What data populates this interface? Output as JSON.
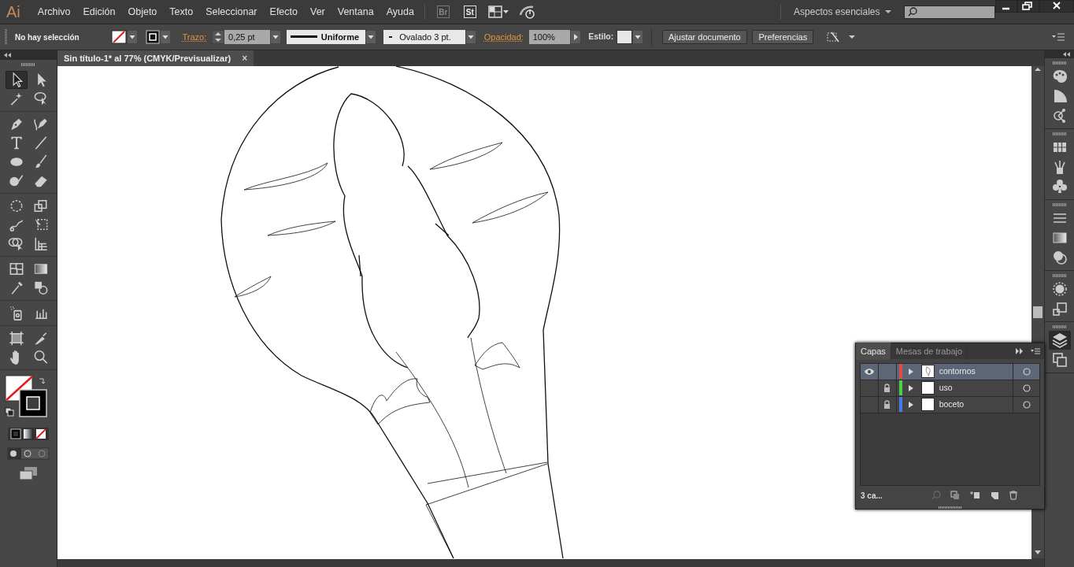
{
  "app": {
    "logo": "Ai",
    "menus": [
      "Archivo",
      "Edición",
      "Objeto",
      "Texto",
      "Seleccionar",
      "Efecto",
      "Ver",
      "Ventana",
      "Ayuda"
    ],
    "bridge": "Br",
    "stock": "St",
    "workspace": "Aspectos esenciales"
  },
  "control_bar": {
    "selection_status": "No hay selección",
    "stroke_label": "Trazo:",
    "stroke_weight": "0,25 pt",
    "stroke_profile": "Uniforme",
    "brush": "Ovalado 3 pt.",
    "opacity_label": "Opacidad:",
    "opacity": "100%",
    "style_label": "Estilo:",
    "buttons": [
      "Ajustar documento",
      "Preferencias"
    ]
  },
  "document_tab": {
    "title": "Sin título-1* al 77% (CMYK/Previsualizar)",
    "close": "×"
  },
  "tool_groups": [
    {
      "tools": [
        {
          "kind": "selection",
          "selected": true
        },
        {
          "kind": "direct",
          "selected": false
        },
        {
          "kind": "wand",
          "selected": false
        },
        {
          "kind": "lasso",
          "selected": false
        }
      ]
    },
    {
      "tools": [
        {
          "kind": "pen",
          "selected": false
        },
        {
          "kind": "curvature",
          "selected": false
        },
        {
          "kind": "type",
          "selected": false
        },
        {
          "kind": "line",
          "selected": false
        },
        {
          "kind": "ellipse",
          "selected": false
        },
        {
          "kind": "brush",
          "selected": false
        },
        {
          "kind": "blob",
          "selected": false
        },
        {
          "kind": "eraser",
          "selected": false
        }
      ]
    },
    {
      "tools": [
        {
          "kind": "rotate",
          "selected": false
        },
        {
          "kind": "scale",
          "selected": false
        },
        {
          "kind": "warp",
          "selected": false
        },
        {
          "kind": "freetransform",
          "selected": false
        },
        {
          "kind": "shapebuilder",
          "selected": false
        },
        {
          "kind": "perspective",
          "selected": false
        }
      ]
    },
    {
      "tools": [
        {
          "kind": "mesh",
          "selected": false
        },
        {
          "kind": "gradient",
          "selected": false
        },
        {
          "kind": "eyedropper",
          "selected": false
        },
        {
          "kind": "blend",
          "selected": false
        }
      ]
    },
    {
      "tools": [
        {
          "kind": "spray",
          "selected": false
        },
        {
          "kind": "graph",
          "selected": false
        }
      ]
    },
    {
      "tools": [
        {
          "kind": "artboard",
          "selected": false
        },
        {
          "kind": "slice",
          "selected": false
        },
        {
          "kind": "hand",
          "selected": false
        },
        {
          "kind": "zoom",
          "selected": false
        }
      ]
    }
  ],
  "dock": [
    {
      "items": [
        {
          "kind": "palette",
          "selected": false
        },
        {
          "kind": "guide",
          "selected": false
        },
        {
          "kind": "link",
          "selected": false
        }
      ]
    },
    {
      "items": [
        {
          "kind": "swatches",
          "selected": false
        },
        {
          "kind": "brushes",
          "selected": false
        },
        {
          "kind": "club",
          "selected": false
        }
      ]
    },
    {
      "items": [
        {
          "kind": "stroke",
          "selected": false
        },
        {
          "kind": "gradient",
          "selected": false
        },
        {
          "kind": "transparency",
          "selected": false
        }
      ]
    },
    {
      "items": [
        {
          "kind": "appearance",
          "selected": false
        },
        {
          "kind": "transform",
          "selected": false
        }
      ]
    },
    {
      "items": [
        {
          "kind": "layers",
          "selected": true
        },
        {
          "kind": "artboards",
          "selected": false
        }
      ]
    }
  ],
  "layers_panel": {
    "tabs": [
      {
        "label": "Capas",
        "selected": true
      },
      {
        "label": "Mesas de trabajo",
        "selected": false
      }
    ],
    "layers": [
      {
        "name": "contornos",
        "visible": true,
        "locked": false,
        "color": "#e24a4a",
        "selected": true
      },
      {
        "name": "uso",
        "visible": false,
        "locked": true,
        "color": "#44d444",
        "selected": false
      },
      {
        "name": "boceto",
        "visible": false,
        "locked": true,
        "color": "#4a7ae6",
        "selected": false
      }
    ],
    "count": "3 ca..."
  }
}
